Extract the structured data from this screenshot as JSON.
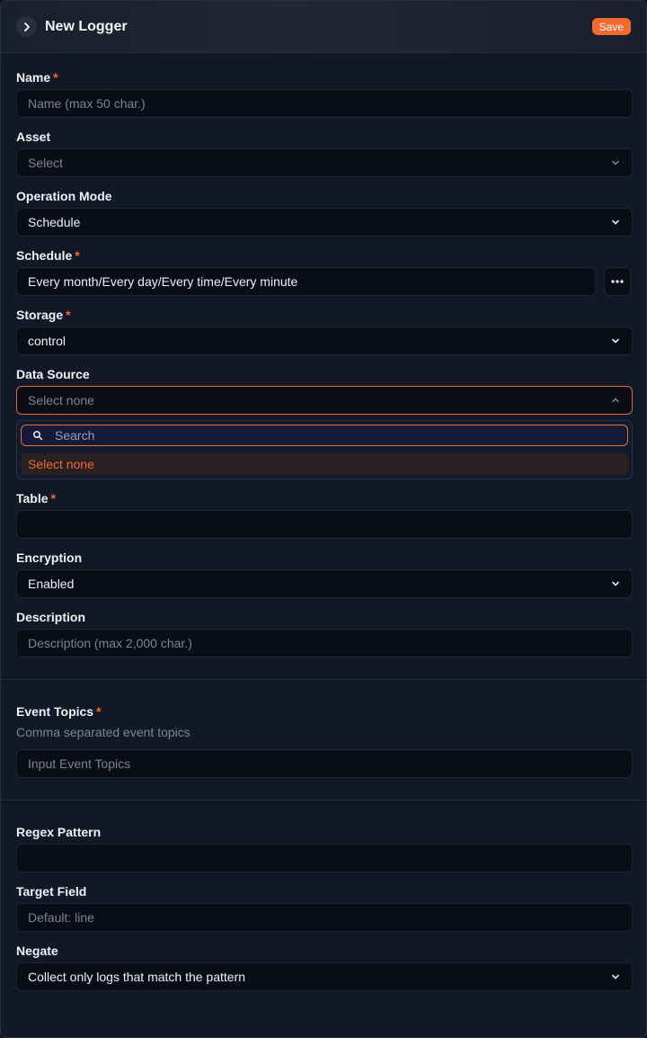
{
  "header": {
    "title": "New Logger",
    "save_label": "Save"
  },
  "fields": {
    "name": {
      "label": "Name",
      "placeholder": "Name (max 50 char.)"
    },
    "asset": {
      "label": "Asset",
      "placeholder": "Select"
    },
    "operation_mode": {
      "label": "Operation Mode",
      "value": "Schedule"
    },
    "schedule": {
      "label": "Schedule",
      "value": "Every month/Every day/Every time/Every minute"
    },
    "storage": {
      "label": "Storage",
      "value": "control"
    },
    "data_source": {
      "label": "Data Source",
      "placeholder": "Select none",
      "search_placeholder": "Search",
      "options": [
        "Select none"
      ]
    },
    "table": {
      "label": "Table",
      "value": ""
    },
    "encryption": {
      "label": "Encryption",
      "value": "Enabled"
    },
    "description": {
      "label": "Description",
      "placeholder": "Description (max 2,000 char.)"
    },
    "event_topics": {
      "label": "Event Topics",
      "helper": "Comma separated event topics",
      "placeholder": "Input Event Topics"
    },
    "regex_pattern": {
      "label": "Regex Pattern",
      "value": ""
    },
    "target_field": {
      "label": "Target Field",
      "placeholder": "Default: line"
    },
    "negate": {
      "label": "Negate",
      "value": "Collect only logs that match the pattern"
    }
  },
  "required_marker": "*",
  "colors": {
    "accent": "#f26a2e",
    "panel": "#131826",
    "input": "#0a0d15"
  }
}
